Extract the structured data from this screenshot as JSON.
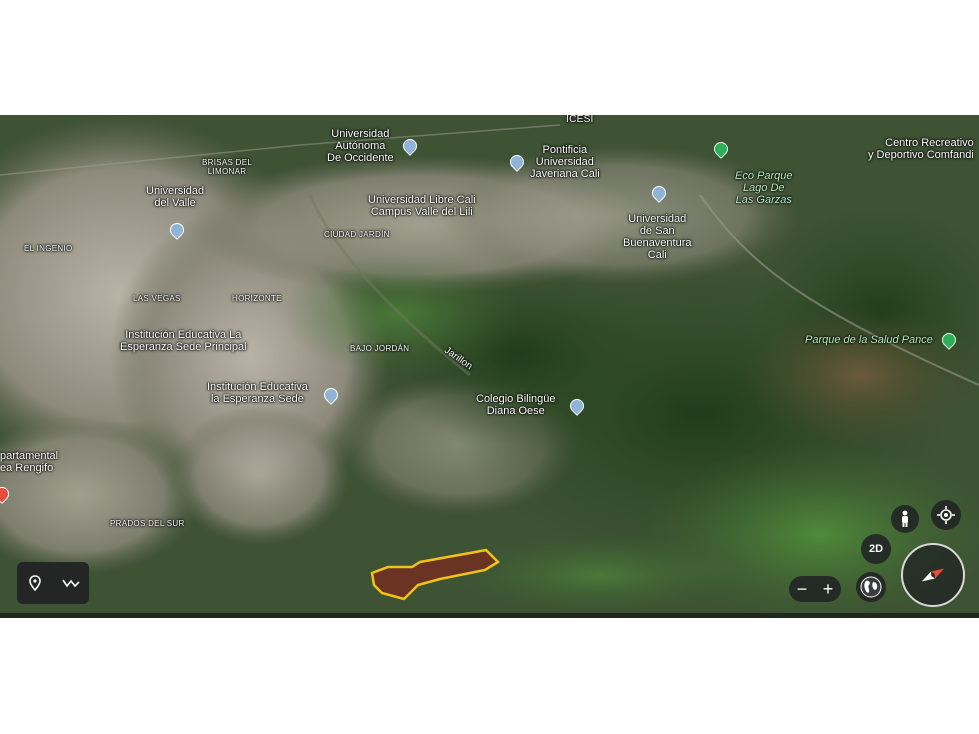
{
  "map": {
    "labels": {
      "icesi": "ICESI",
      "uao": "Universidad\nAutónoma\nDe Occidente",
      "javeriana": "Pontificia\nUniversidad\nJaveriana Cali",
      "comfandi": "Centro Recreativo\ny Deportivo Comfandi",
      "brisas": "BRISAS DEL\nLIMONAR",
      "univalle": "Universidad\ndel Valle",
      "libre": "Universidad Libre Cali\nCampus Valle del Lili",
      "ecoparque": "Eco Parque\nLago De\nLas Garzas",
      "ingenio": "EL INGENIO",
      "ciudadjardin": "CIUDAD JARDÍN",
      "sanbuenaventura": "Universidad\nde San\nBuenaventura\nCali",
      "lasvegas": "LAS VEGAS",
      "horizonte": "HORIZONTE",
      "esperanza1": "Institución Educativa La\nEsperanza Sede Principal",
      "bajojordan": "BAJO JORDÁN",
      "jarillon": "Jarillon",
      "parquesalud": "Parque de la Salud Pance",
      "esperanza2": "Institución Educativa\nla Esperanza Sede",
      "bilingue": "Colegio Bilingüe\nDiana Oese",
      "departamental": "partamental\nea Rengifo",
      "prados": "PRADOS DEL SUR"
    },
    "controls": {
      "mode_2d": "2D",
      "zoom_out": "−",
      "zoom_in": "+"
    },
    "icons": {
      "pin": "location-pin-icon",
      "path": "measure-path-icon",
      "person": "street-view-person-icon",
      "locate": "my-location-icon",
      "globe": "globe-icon",
      "compass": "compass-icon"
    },
    "colors": {
      "plot_outline": "#f2c21b",
      "plot_fill": "#7a2a1e"
    }
  }
}
